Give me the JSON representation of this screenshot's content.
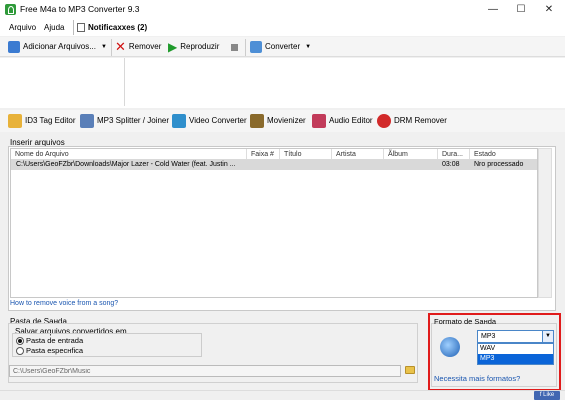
{
  "window": {
    "title": "Free M4a to MP3 Converter 9.3",
    "minimize": "—",
    "maximize": "☐",
    "close": "✕"
  },
  "menu": {
    "file": "Arquivo",
    "help": "Ajuda",
    "notifications": "Notificaxxes (2)"
  },
  "toolbar": {
    "add_files": "Adicionar Arquivos...",
    "remove": "Remover",
    "play": "Reproduzir",
    "convert": "Converter"
  },
  "tools": [
    {
      "label": "ID3 Tag Editor",
      "icon": "tag-editor-icon"
    },
    {
      "label": "MP3 Splitter / Joiner",
      "icon": "splitter-icon"
    },
    {
      "label": "Video Converter",
      "icon": "video-converter-icon"
    },
    {
      "label": "Movienizer",
      "icon": "movienizer-icon"
    },
    {
      "label": "Audio Editor",
      "icon": "audio-editor-icon"
    },
    {
      "label": "DRM Remover",
      "icon": "drm-remover-icon"
    }
  ],
  "files": {
    "group_label": "Inserir arquivos",
    "columns": [
      "Nome do Arquivo",
      "Faixa #",
      "Título",
      "Artista",
      "Ãlbum",
      "Dura...",
      "Estado"
    ],
    "rows": [
      [
        "C:\\Users\\GeoFZbr\\Downloads\\Major Lazer - Cold Water (feat. Justin ...",
        "",
        "",
        "",
        "",
        "03:08",
        "Nro processado"
      ]
    ],
    "voice_link": "How to remove voice from a song?"
  },
  "output_folder": {
    "label": "Pasta de Saнda",
    "save_group_label": "Salvar arquivos convertidos em",
    "options": [
      "Pasta de entrada",
      "Pasta especнfica"
    ],
    "selected_index": 0,
    "path": "C:\\Users\\GeoFZbr\\Music"
  },
  "output_format": {
    "label": "Formato de Saнda",
    "selected": "MP3",
    "options": [
      "WAV",
      "MP3"
    ],
    "highlighted": "MP3",
    "more_link": "Necessita mais formatos?"
  },
  "status": {
    "like": "Like"
  },
  "colors": {
    "highlight_border": "#e01b1b",
    "selection": "#0a64d8",
    "link": "#1a56b0"
  }
}
